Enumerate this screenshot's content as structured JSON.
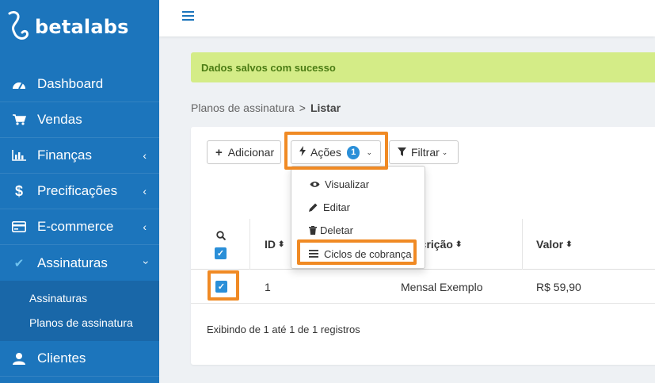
{
  "sidebar": {
    "logo_text": "betalabs",
    "items": [
      {
        "label": "Dashboard",
        "icon": "dashboard-icon"
      },
      {
        "label": "Vendas",
        "icon": "cart-icon"
      },
      {
        "label": "Finanças",
        "icon": "bar-chart-icon"
      },
      {
        "label": "Precificações",
        "icon": "dollar-icon"
      },
      {
        "label": "E-commerce",
        "icon": "credit-card-icon"
      },
      {
        "label": "Assinaturas",
        "icon": "check-icon"
      },
      {
        "label": "Clientes",
        "icon": "user-icon"
      }
    ],
    "subitems": [
      {
        "label": "Assinaturas"
      },
      {
        "label": "Planos de assinatura"
      }
    ]
  },
  "alert": {
    "text": "Dados salvos com sucesso"
  },
  "breadcrumb": {
    "parent": "Planos de assinatura",
    "separator": ">",
    "current": "Listar"
  },
  "toolbar": {
    "add_label": "Adicionar",
    "actions_label": "Ações",
    "actions_count": "1",
    "filter_label": "Filtrar"
  },
  "dropdown": {
    "items": [
      {
        "label": "Visualizar",
        "icon": "eye-icon"
      },
      {
        "label": "Editar",
        "icon": "pencil-icon"
      },
      {
        "label": "Deletar",
        "icon": "trash-icon"
      },
      {
        "label": "Ciclos de cobrança",
        "icon": "list-icon"
      }
    ]
  },
  "table": {
    "headers": {
      "id": "ID",
      "description": "Descrição",
      "value": "Valor"
    },
    "rows": [
      {
        "id": "1",
        "description": "Mensal Exemplo",
        "value": "R$ 59,90",
        "checked": true
      }
    ]
  },
  "footer": {
    "text": "Exibindo de 1 até 1 de 1 registros"
  },
  "colors": {
    "sidebar": "#1c75bc",
    "accent": "#2a8fd8",
    "highlight": "#f08a24",
    "alert_bg": "#d4ec87",
    "alert_text": "#4b7c14"
  }
}
